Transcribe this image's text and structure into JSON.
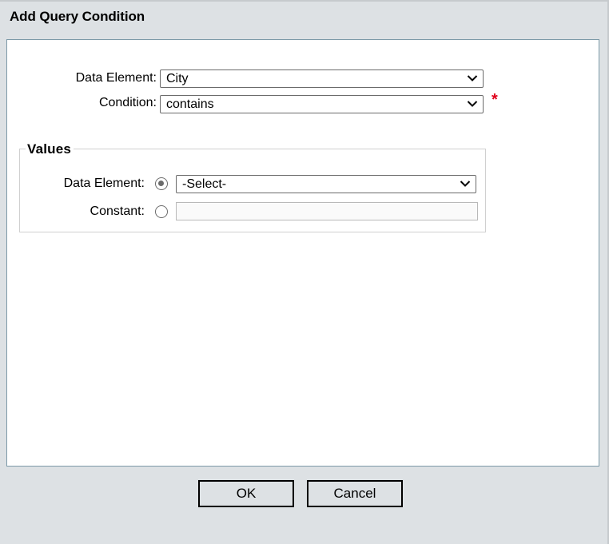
{
  "dialog": {
    "title": "Add Query Condition"
  },
  "query": {
    "data_element_label": "Data Element:",
    "data_element_value": "City",
    "condition_label": "Condition:",
    "condition_value": "contains",
    "required_mark": "*"
  },
  "values": {
    "legend": "Values",
    "data_element_label": "Data Element:",
    "data_element_value": "-Select-",
    "data_element_checked": true,
    "constant_label": "Constant:",
    "constant_value": "",
    "constant_checked": false
  },
  "buttons": {
    "ok_label": "OK",
    "cancel_label": "Cancel"
  },
  "colors": {
    "required": "#e0001b",
    "panel_border": "#7d9aa8",
    "background": "#dde1e4"
  },
  "icons": {
    "dropdown": "chevron-down-icon"
  }
}
